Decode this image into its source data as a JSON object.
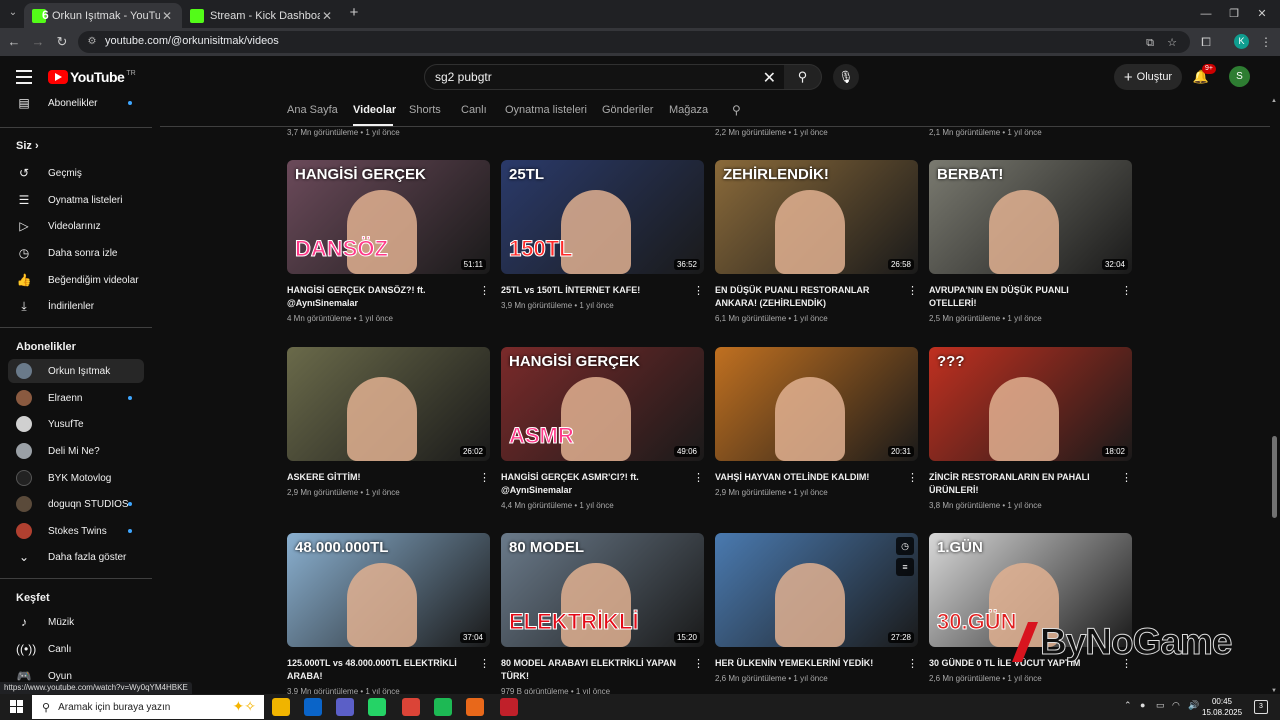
{
  "browser": {
    "tabs": [
      {
        "title": "Orkun Işıtmak - YouTube",
        "favicon_color": "#53fc18"
      },
      {
        "title": "Stream - Kick Dashboard",
        "favicon_color": "#53fc18"
      }
    ],
    "tab_overlay_digit": "6",
    "url": "youtube.com/@orkunisitmak/videos",
    "profile_initial": "K"
  },
  "header": {
    "logo_text": "YouTube",
    "logo_region": "TR",
    "search_query": "sg2 pubgtr",
    "create_label": "Oluştur",
    "notification_count": "9+",
    "avatar_initial": "S"
  },
  "sidebar": {
    "top_item": {
      "label": "Abonelikler",
      "icon": "subscriptions-icon"
    },
    "you_heading": "Siz",
    "you_items": [
      {
        "label": "Geçmiş",
        "icon": "history-icon"
      },
      {
        "label": "Oynatma listeleri",
        "icon": "playlists-icon"
      },
      {
        "label": "Videolarınız",
        "icon": "your-videos-icon"
      },
      {
        "label": "Daha sonra izle",
        "icon": "watch-later-icon"
      },
      {
        "label": "Beğendiğim videolar",
        "icon": "liked-icon"
      },
      {
        "label": "İndirilenler",
        "icon": "download-icon"
      }
    ],
    "subs_heading": "Abonelikler",
    "subscriptions": [
      {
        "label": "Orkun Işıtmak",
        "color": "#6a7a8a",
        "dot": false
      },
      {
        "label": "Elraenn",
        "color": "#8a5a40",
        "dot": true
      },
      {
        "label": "YusufTe",
        "color": "#d0d0d0",
        "dot": false
      },
      {
        "label": "Deli Mi Ne?",
        "color": "#9aa0a6",
        "dot": false
      },
      {
        "label": "BYK Motovlog",
        "color": "#222222",
        "dot": false
      },
      {
        "label": "doguqn STUDIOS",
        "color": "#5a4a3a",
        "dot": true
      },
      {
        "label": "Stokes Twins",
        "color": "#b04030",
        "dot": true
      }
    ],
    "show_more": "Daha fazla göster",
    "explore_heading": "Keşfet",
    "explore_items": [
      {
        "label": "Müzik",
        "icon": "music-icon"
      },
      {
        "label": "Canlı",
        "icon": "live-icon"
      },
      {
        "label": "Oyun",
        "icon": "gaming-icon"
      }
    ]
  },
  "channel_tabs": [
    "Ana Sayfa",
    "Videolar",
    "Shorts",
    "Canlı",
    "Oynatma listeleri",
    "Gönderiler",
    "Mağaza"
  ],
  "previous_row_meta": [
    "3,7 Mn görüntüleme • 1 yıl önce",
    "",
    "2,2 Mn görüntüleme • 1 yıl önce",
    "2,1 Mn görüntüleme • 1 yıl önce"
  ],
  "videos": [
    {
      "title": "HANGİSİ GERÇEK DANSÖZ?! ft. @AynıSinemalar",
      "meta": "4 Mn görüntüleme • 1 yıl önce",
      "duration": "51:11",
      "thumb_text": [
        "HANGİSİ GERÇEK",
        "DANSÖZ"
      ],
      "bg": "#6b4a5a",
      "accent": "#ff3a8a"
    },
    {
      "title": "25TL vs 150TL İNTERNET KAFE!",
      "meta": "3,9 Mn görüntüleme • 1 yıl önce",
      "duration": "36:52",
      "thumb_text": [
        "25TL",
        "150TL"
      ],
      "bg": "#2a3a6a",
      "accent": "#ff2a2a"
    },
    {
      "title": "EN DÜŞÜK PUANLI RESTORANLAR ANKARA! (ZEHİRLENDİK)",
      "meta": "6,1 Mn görüntüleme • 1 yıl önce",
      "duration": "26:58",
      "thumb_text": [
        "ZEHİRLENDİK!",
        ""
      ],
      "bg": "#8a6a3a",
      "accent": "#e02020"
    },
    {
      "title": "AVRUPA'NIN EN DÜŞÜK PUANLI OTELLERİ!",
      "meta": "2,5 Mn görüntüleme • 1 yıl önce",
      "duration": "32:04",
      "thumb_text": [
        "BERBAT!",
        ""
      ],
      "bg": "#7a7a70",
      "accent": "#e02020"
    },
    {
      "title": "ASKERE GİTTİM!",
      "meta": "2,9 Mn görüntüleme • 1 yıl önce",
      "duration": "26:02",
      "thumb_text": [
        "",
        ""
      ],
      "bg": "#6a6a4a",
      "accent": "#e30a17"
    },
    {
      "title": "HANGİSİ GERÇEK ASMR'CI?! ft. @AynıSinemalar",
      "meta": "4,4 Mn görüntüleme • 1 yıl önce",
      "duration": "49:06",
      "thumb_text": [
        "HANGİSİ GERÇEK",
        "ASMR"
      ],
      "bg": "#7a2a2a",
      "accent": "#ff3a8a"
    },
    {
      "title": "VAHŞİ HAYVAN OTELİNDE KALDIM!",
      "meta": "2,9 Mn görüntüleme • 1 yıl önce",
      "duration": "20:31",
      "thumb_text": [
        "",
        ""
      ],
      "bg": "#c07020",
      "accent": "#4a7a2a"
    },
    {
      "title": "ZİNCİR RESTORANLARIN EN PAHALI ÜRÜNLERİ!",
      "meta": "3,8 Mn görüntüleme • 1 yıl önce",
      "duration": "18:02",
      "thumb_text": [
        "???",
        ""
      ],
      "bg": "#c03020",
      "accent": "#ffcc00"
    },
    {
      "title": "125.000TL vs 48.000.000TL ELEKTRİKLİ ARABA!",
      "meta": "3,9 Mn görüntüleme • 1 yıl önce",
      "duration": "37:04",
      "thumb_text": [
        "48.000.000TL",
        ""
      ],
      "bg": "#8ab0d0",
      "accent": "#f0c000"
    },
    {
      "title": "80 MODEL ARABAYI ELEKTRİKLİ YAPAN TÜRK!",
      "meta": "979 B görüntüleme • 1 yıl önce",
      "duration": "15:20",
      "thumb_text": [
        "80 MODEL",
        "ELEKTRİKLİ"
      ],
      "bg": "#6a7a8a",
      "accent": "#e30a17"
    },
    {
      "title": "HER ÜLKENİN YEMEKLERİNİ YEDİK!",
      "meta": "2,6 Mn görüntüleme • 1 yıl önce",
      "duration": "27:28",
      "thumb_text": [
        "",
        ""
      ],
      "bg": "#4a7ab0",
      "accent": "#c08030"
    },
    {
      "title": "30 GÜNDE 0 TL İLE VÜCUT YAPTIM",
      "meta": "2,6 Mn görüntüleme • 1 yıl önce",
      "duration": "",
      "thumb_text": [
        "1.GÜN",
        "30.GÜN"
      ],
      "bg": "#d8d8d8",
      "accent": "#e02020"
    }
  ],
  "watermark": "ByNoGame",
  "status_url": "https://www.youtube.com/watch?v=Wy0qYM4HBKE",
  "taskbar": {
    "search_placeholder": "Aramak için buraya yazın",
    "apps": [
      {
        "name": "file-explorer",
        "color": "#f0b400"
      },
      {
        "name": "outlook",
        "color": "#0a64c8"
      },
      {
        "name": "teams",
        "color": "#5b5fc7"
      },
      {
        "name": "whatsapp",
        "color": "#25d366"
      },
      {
        "name": "chrome",
        "color": "#db4437"
      },
      {
        "name": "spotify",
        "color": "#1db954"
      },
      {
        "name": "app-orange",
        "color": "#e8681a"
      },
      {
        "name": "app-red",
        "color": "#c0202a"
      }
    ],
    "time": "00:45",
    "date": "15.08.2025",
    "notif_count": "3"
  }
}
